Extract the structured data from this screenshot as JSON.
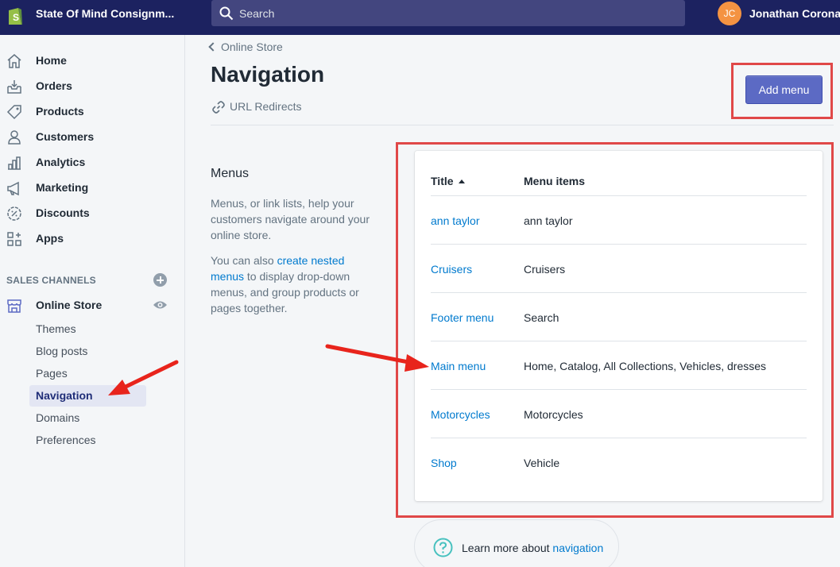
{
  "topbar": {
    "store_name": "State Of Mind Consignm...",
    "search_placeholder": "Search",
    "user_initials": "JC",
    "user_name": "Jonathan Corona"
  },
  "sidebar": {
    "items": [
      {
        "label": "Home",
        "icon": "home-icon"
      },
      {
        "label": "Orders",
        "icon": "orders-icon"
      },
      {
        "label": "Products",
        "icon": "tag-icon"
      },
      {
        "label": "Customers",
        "icon": "person-icon"
      },
      {
        "label": "Analytics",
        "icon": "bar-chart-icon"
      },
      {
        "label": "Marketing",
        "icon": "megaphone-icon"
      },
      {
        "label": "Discounts",
        "icon": "discount-icon"
      },
      {
        "label": "Apps",
        "icon": "apps-icon"
      }
    ],
    "sales_channels_label": "SALES CHANNELS",
    "online_store_label": "Online Store",
    "sub_items": [
      "Themes",
      "Blog posts",
      "Pages",
      "Navigation",
      "Domains",
      "Preferences"
    ],
    "active_sub_item": "Navigation"
  },
  "main": {
    "breadcrumb": "Online Store",
    "title": "Navigation",
    "url_redirects": "URL Redirects",
    "add_menu_label": "Add menu",
    "menus_heading": "Menus",
    "menus_desc": "Menus, or link lists, help your customers navigate around your online store.",
    "menus_desc2_pre": "You can also ",
    "menus_desc2_link": "create nested menus",
    "menus_desc2_post": " to display drop-down menus, and group products or pages together.",
    "table": {
      "col_title": "Title",
      "col_items": "Menu items",
      "rows": [
        {
          "title": "ann taylor",
          "items": "ann taylor"
        },
        {
          "title": "Cruisers",
          "items": "Cruisers"
        },
        {
          "title": "Footer menu",
          "items": "Search"
        },
        {
          "title": "Main menu",
          "items": "Home, Catalog, All Collections, Vehicles, dresses"
        },
        {
          "title": "Motorcycles",
          "items": "Motorcycles"
        },
        {
          "title": "Shop",
          "items": "Vehicle"
        }
      ]
    },
    "learn_more_pre": "Learn more about ",
    "learn_more_link": "navigation"
  },
  "colors": {
    "topbar": "#1c2260",
    "accent_button": "#5c6ac4",
    "link": "#007ace",
    "annotation_red": "#e04848",
    "avatar": "#f49342"
  }
}
